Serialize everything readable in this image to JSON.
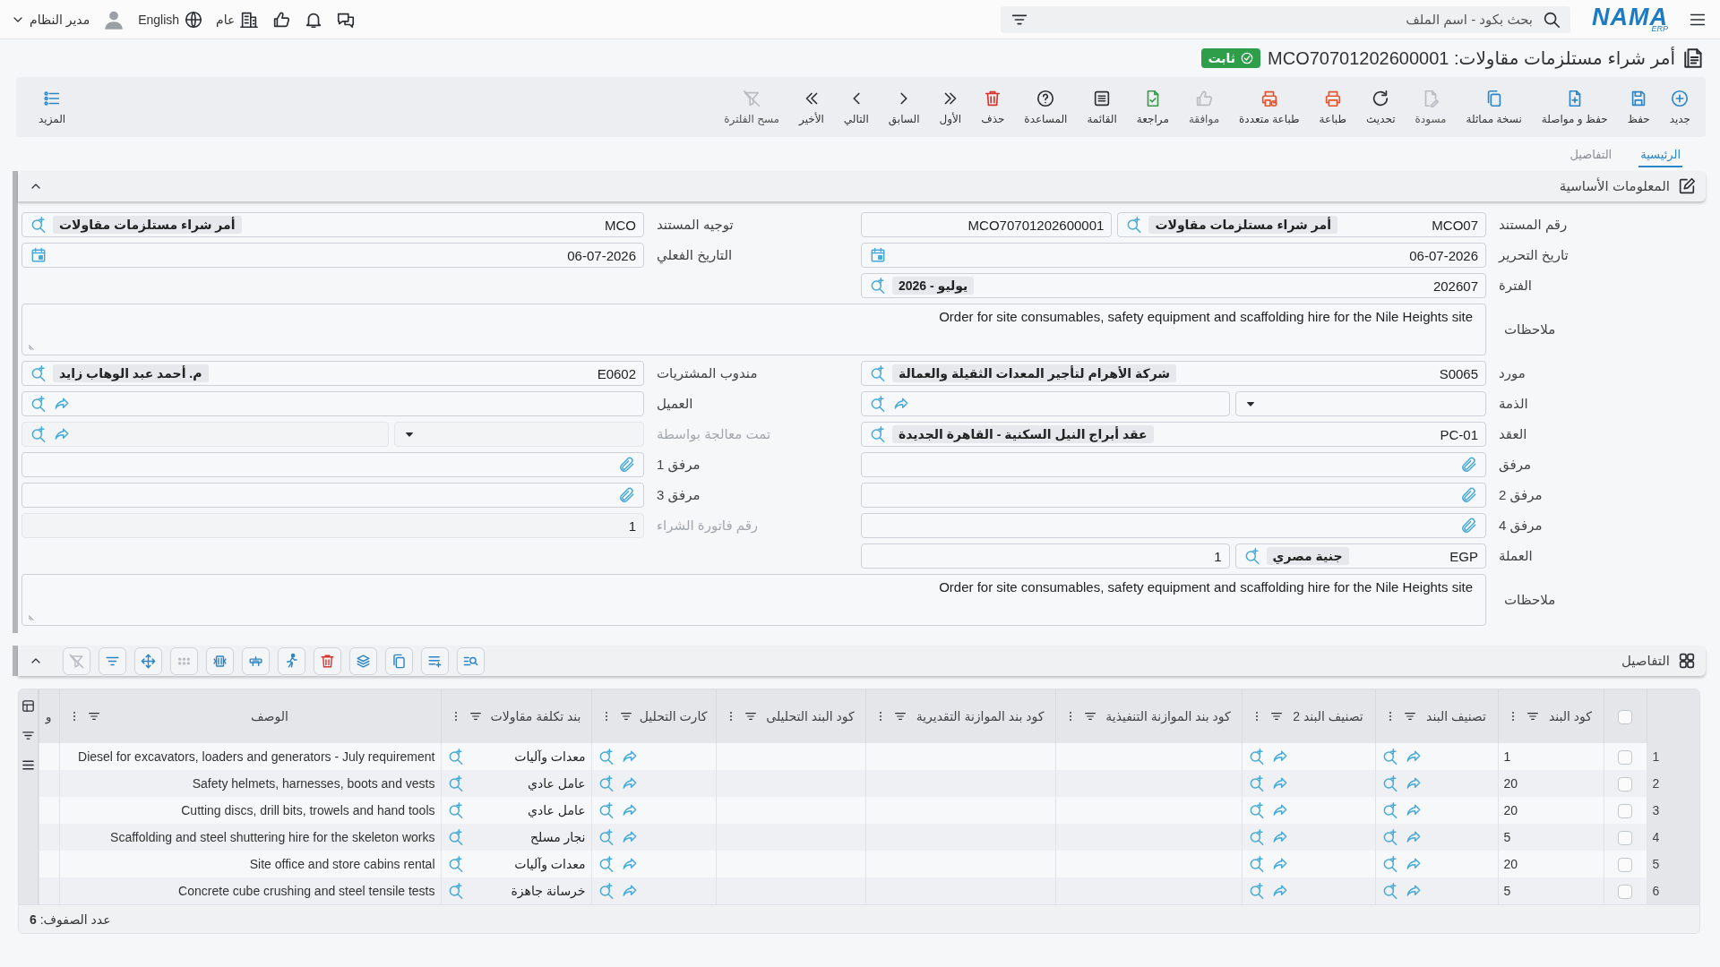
{
  "topbar": {
    "logo": {
      "name": "NAMA",
      "sub": "ERP"
    },
    "search": {
      "placeholder": "بحث بكود - اسم الملف"
    },
    "org": "عام",
    "language": "English",
    "user": "مدير النظام"
  },
  "title": {
    "text": "أمر شراء مستلزمات مقاولات: MCO70701202600001",
    "status": "ثابت"
  },
  "toolbar": [
    {
      "label": "جديد",
      "disabled": false
    },
    {
      "label": "حفظ",
      "disabled": false
    },
    {
      "label": "حفظ و مواصلة",
      "disabled": false
    },
    {
      "label": "نسخة مماثلة",
      "disabled": false
    },
    {
      "label": "مسودة",
      "disabled": true
    },
    {
      "label": "تحديث",
      "disabled": false
    },
    {
      "label": "طباعة",
      "disabled": false
    },
    {
      "label": "طباعة متعددة",
      "disabled": false
    },
    {
      "label": "موافقة",
      "disabled": true
    },
    {
      "label": "مراجعة",
      "disabled": false
    },
    {
      "label": "القائمة",
      "disabled": false
    },
    {
      "label": "المساعدة",
      "disabled": false
    },
    {
      "label": "حذف",
      "disabled": false
    },
    {
      "label": "الأول",
      "disabled": false
    },
    {
      "label": "السابق",
      "disabled": false
    },
    {
      "label": "التالي",
      "disabled": false
    },
    {
      "label": "الأخير",
      "disabled": false
    },
    {
      "label": "مسح الفلترة",
      "disabled": true
    }
  ],
  "more": "المزيد",
  "tabs": [
    {
      "label": "الرئيسية",
      "selected": true
    },
    {
      "label": "التفاصيل",
      "selected": false
    }
  ],
  "main_section": {
    "title": "المعلومات الأساسية",
    "expanded": true,
    "rows": [
      {
        "cells": [
          {
            "label": "رقم المستند",
            "kind": "doc_number",
            "value": "MCO07",
            "chip": "أمر شراء مستلزمات مقاولات",
            "extra": "MCO70701202600001",
            "disabled": false
          },
          {
            "label": "توجيه المستند",
            "kind": "lookup",
            "value": "MCO",
            "chip": "أمر شراء مستلزمات مقاولات",
            "disabled": false
          }
        ]
      },
      {
        "cells": [
          {
            "label": "تاريخ التحرير",
            "kind": "date",
            "value": "06-07-2026",
            "disabled": false
          },
          {
            "label": "التاريخ الفعلي",
            "kind": "date",
            "value": "06-07-2026",
            "disabled": false
          }
        ]
      },
      {
        "cells": [
          {
            "label": "الفترة",
            "kind": "lookup",
            "value": "202607",
            "chip": "يوليو - 2026",
            "disabled": false
          }
        ]
      },
      {
        "cells": [
          {
            "label": "ملاحظات",
            "kind": "notes",
            "value": "Order for site consumables, safety equipment and scaffolding hire for the Nile Heights site",
            "disabled": false
          }
        ]
      },
      {
        "cells": [
          {
            "label": "مورد",
            "kind": "lookup",
            "value": "S0065",
            "chip": "شركة الأهرام لتأجير المعدات الثقيلة والعمالة",
            "disabled": false
          },
          {
            "label": "مندوب المشتريات",
            "kind": "lookup",
            "value": "E0602",
            "chip": "م. أحمد عبد الوهاب زايد",
            "disabled": false
          }
        ]
      },
      {
        "cells": [
          {
            "label": "الذمة",
            "kind": "select_link",
            "disabled": false
          },
          {
            "label": "العميل",
            "kind": "link_lookup",
            "disabled": false
          }
        ]
      },
      {
        "cells": [
          {
            "label": "العقد",
            "kind": "lookup",
            "value": "PC-01",
            "chip": "عقد أبراج النيل السكنية - القاهرة الجديدة",
            "disabled": false
          },
          {
            "label": "تمت معالجة بواسطة",
            "kind": "select_link",
            "disabled": true
          }
        ]
      },
      {
        "cells": [
          {
            "label": "مرفق",
            "kind": "attach",
            "disabled": false
          },
          {
            "label": "مرفق 1",
            "kind": "attach",
            "disabled": false
          }
        ]
      },
      {
        "cells": [
          {
            "label": "مرفق 2",
            "kind": "attach",
            "disabled": false
          },
          {
            "label": "مرفق 3",
            "kind": "attach",
            "disabled": false
          }
        ]
      },
      {
        "cells": [
          {
            "label": "مرفق 4",
            "kind": "attach",
            "disabled": false
          },
          {
            "label": "رقم فاتورة الشراء",
            "kind": "text",
            "value": "1",
            "disabled": true
          }
        ]
      },
      {
        "cells": [
          {
            "label": "العملة",
            "kind": "currency",
            "value": "EGP",
            "chip": "جنية مصري",
            "extra": "1",
            "disabled": false
          }
        ]
      },
      {
        "cells": [
          {
            "label": "ملاحظات",
            "kind": "notes",
            "value": "Order for site consumables, safety equipment and scaffolding hire for the Nile Heights site",
            "disabled": false
          }
        ]
      }
    ]
  },
  "details_section": {
    "title": "التفاصيل",
    "expanded": true,
    "tools": [
      {
        "disabled": true
      },
      {
        "disabled": false
      },
      {
        "disabled": false
      },
      {
        "disabled": true
      },
      {
        "disabled": false
      },
      {
        "disabled": false
      },
      {
        "disabled": false
      },
      {
        "disabled": false
      },
      {
        "disabled": false
      },
      {
        "disabled": false
      },
      {
        "disabled": false
      },
      {
        "disabled": false
      }
    ],
    "table": {
      "all_checked": false,
      "columns": [
        {
          "label": "كود البند",
          "kind": "code",
          "filterable": true
        },
        {
          "label": "تصنيف البند",
          "kind": "link",
          "filterable": true
        },
        {
          "label": "تصنيف البند 2",
          "kind": "link",
          "filterable": true
        },
        {
          "label": "كود بند الموازنة التنفيذية",
          "kind": "blank",
          "filterable": true
        },
        {
          "label": "كود بند الموازنة التقديرية",
          "kind": "blank",
          "filterable": true
        },
        {
          "label": "كود البند التحليلى",
          "kind": "blank",
          "filterable": true
        },
        {
          "label": "كارت التحليل",
          "kind": "link",
          "filterable": true
        },
        {
          "label": "بند تكلفة مقاولات",
          "kind": "cost",
          "filterable": true
        },
        {
          "label": "الوصف",
          "kind": "description",
          "filterable": true
        },
        {
          "label": "و",
          "kind": "blank",
          "filterable": false
        }
      ],
      "rows": [
        {
          "number": "1",
          "checked": false,
          "item_code": "1",
          "cost_item": "معدات وآليات",
          "description": "Diesel for excavators, loaders and generators - July requirement"
        },
        {
          "number": "2",
          "checked": false,
          "item_code": "20",
          "cost_item": "عامل عادي",
          "description": "Safety helmets, harnesses, boots and vests"
        },
        {
          "number": "3",
          "checked": false,
          "item_code": "20",
          "cost_item": "عامل عادي",
          "description": "Cutting discs, drill bits, trowels and hand tools"
        },
        {
          "number": "4",
          "checked": false,
          "item_code": "5",
          "cost_item": "نجار مسلح",
          "description": "Scaffolding and steel shuttering hire for the skeleton works"
        },
        {
          "number": "5",
          "checked": false,
          "item_code": "20",
          "cost_item": "معدات وآليات",
          "description": "Site office and store cabins rental"
        },
        {
          "number": "6",
          "checked": false,
          "item_code": "5",
          "cost_item": "خرسانة جاهزة",
          "description": "Concrete cube crushing and steel tensile tests"
        }
      ]
    },
    "row_count": "عدد الصفوف: **6**"
  }
}
